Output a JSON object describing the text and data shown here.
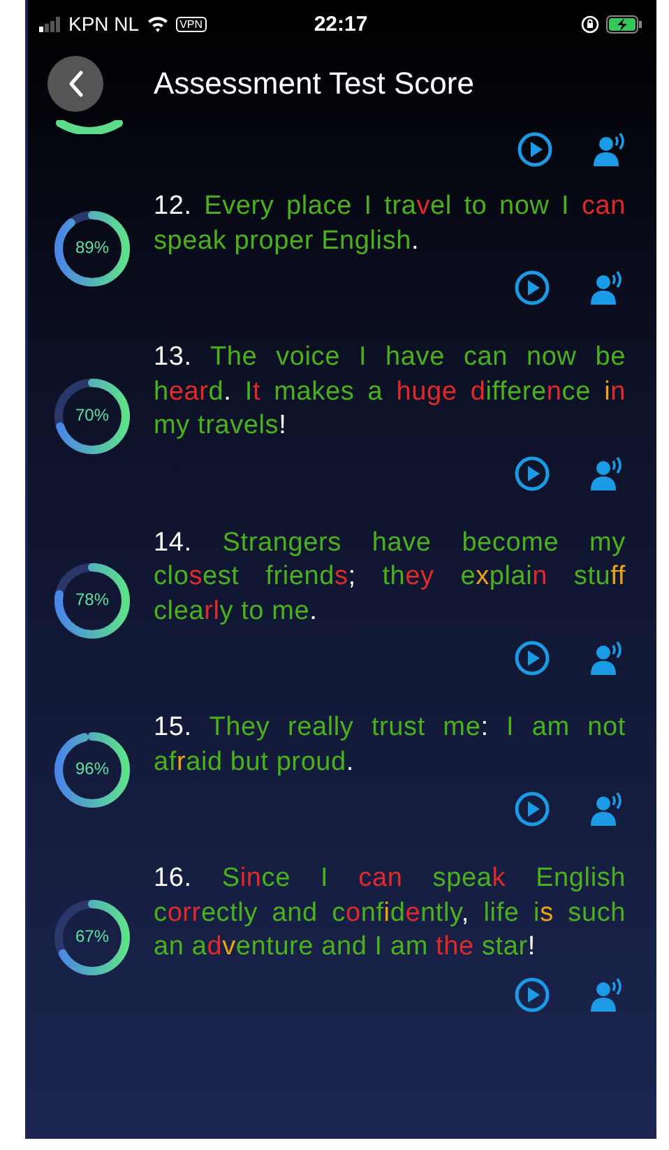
{
  "status_bar": {
    "carrier": "KPN NL",
    "vpn": "VPN",
    "time": "22:17"
  },
  "header": {
    "title": "Assessment Test Score"
  },
  "items": [
    {
      "number": "12.",
      "score": "89%",
      "level": 0.89,
      "segments": [
        {
          "text": "Every place I tra",
          "color": "#4bb01e"
        },
        {
          "text": "v",
          "color": "#e02a2a"
        },
        {
          "text": "el to now I ",
          "color": "#4bb01e"
        },
        {
          "text": "can",
          "color": "#e02a2a"
        },
        {
          "text": " speak proper English",
          "color": "#4bb01e"
        },
        {
          "text": ".",
          "color": "#ffffff"
        }
      ]
    },
    {
      "number": "13.",
      "score": "70%",
      "level": 0.7,
      "segments": [
        {
          "text": "The voice I have can now be h",
          "color": "#4bb01e"
        },
        {
          "text": "ear",
          "color": "#e02a2a"
        },
        {
          "text": "d",
          "color": "#4bb01e"
        },
        {
          "text": ".",
          "color": "#ffffff"
        },
        {
          "text": " I",
          "color": "#4bb01e"
        },
        {
          "text": "t",
          "color": "#e02a2a"
        },
        {
          "text": " makes a ",
          "color": "#4bb01e"
        },
        {
          "text": "huge d",
          "color": "#e02a2a"
        },
        {
          "text": "iffere",
          "color": "#4bb01e"
        },
        {
          "text": "n",
          "color": "#e02a2a"
        },
        {
          "text": "ce ",
          "color": "#4bb01e"
        },
        {
          "text": "i",
          "color": "#e8a317"
        },
        {
          "text": "n",
          "color": "#e02a2a"
        },
        {
          "text": " my travels",
          "color": "#4bb01e"
        },
        {
          "text": "!",
          "color": "#ffffff"
        }
      ]
    },
    {
      "number": "14.",
      "score": "78%",
      "level": 0.78,
      "segments": [
        {
          "text": "Strangers have become my clo",
          "color": "#4bb01e"
        },
        {
          "text": "s",
          "color": "#e02a2a"
        },
        {
          "text": "est friend",
          "color": "#4bb01e"
        },
        {
          "text": "s",
          "color": "#e02a2a"
        },
        {
          "text": ";",
          "color": "#ffffff"
        },
        {
          "text": " th",
          "color": "#4bb01e"
        },
        {
          "text": "ey",
          "color": "#e02a2a"
        },
        {
          "text": " e",
          "color": "#4bb01e"
        },
        {
          "text": "x",
          "color": "#e8a317"
        },
        {
          "text": "plai",
          "color": "#4bb01e"
        },
        {
          "text": "n",
          "color": "#e02a2a"
        },
        {
          "text": " stu",
          "color": "#4bb01e"
        },
        {
          "text": "ff",
          "color": "#e8a317"
        },
        {
          "text": " clea",
          "color": "#4bb01e"
        },
        {
          "text": "rl",
          "color": "#e02a2a"
        },
        {
          "text": "y to me",
          "color": "#4bb01e"
        },
        {
          "text": ".",
          "color": "#ffffff"
        }
      ]
    },
    {
      "number": "15.",
      "score": "96%",
      "level": 0.96,
      "segments": [
        {
          "text": "They really trust me",
          "color": "#4bb01e"
        },
        {
          "text": ":",
          "color": "#ffffff"
        },
        {
          "text": " I am not af",
          "color": "#4bb01e"
        },
        {
          "text": "r",
          "color": "#e8a317"
        },
        {
          "text": "aid but proud",
          "color": "#4bb01e"
        },
        {
          "text": ".",
          "color": "#ffffff"
        }
      ]
    },
    {
      "number": "16.",
      "score": "67%",
      "level": 0.67,
      "segments": [
        {
          "text": "S",
          "color": "#4bb01e"
        },
        {
          "text": "in",
          "color": "#e02a2a"
        },
        {
          "text": "ce I ",
          "color": "#4bb01e"
        },
        {
          "text": "can",
          "color": "#e02a2a"
        },
        {
          "text": " spea",
          "color": "#4bb01e"
        },
        {
          "text": "k",
          "color": "#e02a2a"
        },
        {
          "text": " English c",
          "color": "#4bb01e"
        },
        {
          "text": "orr",
          "color": "#e02a2a"
        },
        {
          "text": "ectly and c",
          "color": "#4bb01e"
        },
        {
          "text": "o",
          "color": "#e02a2a"
        },
        {
          "text": "nf",
          "color": "#4bb01e"
        },
        {
          "text": "i",
          "color": "#e8a317"
        },
        {
          "text": "d",
          "color": "#4bb01e"
        },
        {
          "text": "e",
          "color": "#e02a2a"
        },
        {
          "text": "ntly",
          "color": "#4bb01e"
        },
        {
          "text": ",",
          "color": "#ffffff"
        },
        {
          "text": " life i",
          "color": "#4bb01e"
        },
        {
          "text": "s",
          "color": "#e8a317"
        },
        {
          "text": " such an a",
          "color": "#4bb01e"
        },
        {
          "text": "d",
          "color": "#e02a2a"
        },
        {
          "text": "v",
          "color": "#e8a317"
        },
        {
          "text": "enture and I am ",
          "color": "#4bb01e"
        },
        {
          "text": "the",
          "color": "#e02a2a"
        },
        {
          "text": " star",
          "color": "#4bb01e"
        },
        {
          "text": "!",
          "color": "#ffffff"
        }
      ]
    }
  ]
}
